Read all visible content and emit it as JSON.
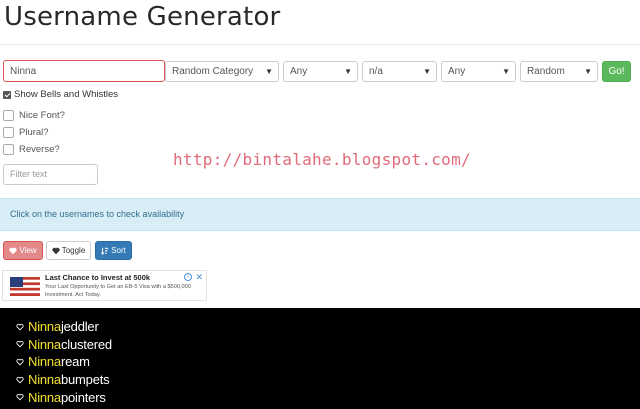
{
  "page": {
    "title": "Username Generator",
    "watermark": "http://bintalahe.blogspot.com/"
  },
  "controls": {
    "name_value": "Ninna",
    "selects": [
      {
        "value": "Random Category"
      },
      {
        "value": "Any"
      },
      {
        "value": "n/a"
      },
      {
        "value": "Any"
      },
      {
        "value": "Random"
      }
    ],
    "go_label": "Go!",
    "bells_label": "Show Bells and Whistles",
    "bells_checked": true,
    "options": [
      {
        "label": "Nice Font?",
        "checked": false
      },
      {
        "label": "Plural?",
        "checked": false
      },
      {
        "label": "Reverse?",
        "checked": false
      }
    ],
    "filter_placeholder": "Filter text"
  },
  "info": {
    "text": "Click on the usernames to check availability"
  },
  "buttons": {
    "view": "View",
    "toggle": "Toggle",
    "sort": "Sort"
  },
  "ad": {
    "title": "Last Chance to Invest at 500k",
    "text": "Your Last Opportunity to Get an EB-5 Visa with a $500,000 Investment. Act Today."
  },
  "results": [
    {
      "prefix": "Ninna",
      "suffix": "jeddler"
    },
    {
      "prefix": "Ninna",
      "suffix": "clustered"
    },
    {
      "prefix": "Ninna",
      "suffix": "ream"
    },
    {
      "prefix": "Ninna",
      "suffix": "bumpets"
    },
    {
      "prefix": "Ninna",
      "suffix": "pointers"
    }
  ],
  "colors": {
    "go": "#5cb85c",
    "view": "#e3898a",
    "sort": "#337ab7",
    "info_bg": "#d9edf7",
    "name_highlight": "#f2e12c",
    "results_bg": "#000000"
  }
}
